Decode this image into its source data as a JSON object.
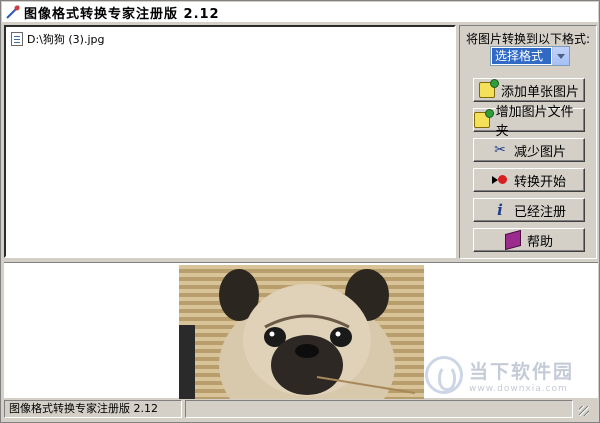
{
  "window": {
    "title": "图像格式转换专家注册版 2.12"
  },
  "file_list": {
    "items": [
      {
        "name": "D:\\狗狗 (3).jpg"
      }
    ]
  },
  "right_panel": {
    "format_label": "将图片转换到以下格式:",
    "format_select": {
      "selected": "选择格式"
    },
    "buttons": {
      "add_single": "添加单张图片",
      "add_folder": "增加图片文件夹",
      "remove": "减少图片",
      "convert": "转换开始",
      "registered": "已经注册",
      "help": "帮助"
    }
  },
  "status_bar": {
    "left": "图像格式转换专家注册版 2.12",
    "right": ""
  },
  "watermark": {
    "main": "当下软件园",
    "url": "www.downxia.com"
  },
  "colors": {
    "window_bg": "#d4d0c8",
    "select_highlight": "#316ac5",
    "convert_dot": "#d81e1e"
  },
  "icons": [
    "app-icon",
    "file-icon",
    "add-image-icon",
    "add-folder-icon",
    "scissors-icon",
    "convert-icon",
    "info-icon",
    "help-book-icon"
  ]
}
